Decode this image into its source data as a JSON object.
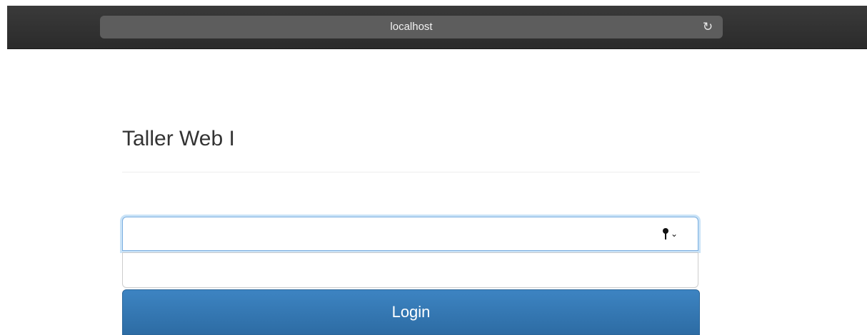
{
  "browser": {
    "address": "localhost",
    "reload_icon": "reload-icon"
  },
  "page": {
    "title": "Taller Web I"
  },
  "form": {
    "username_value": "",
    "password_value": "",
    "keychain_icon": "key-icon",
    "login_label": "Login"
  },
  "colors": {
    "button_primary": "#337ab7",
    "focus_ring": "#66afe9"
  }
}
